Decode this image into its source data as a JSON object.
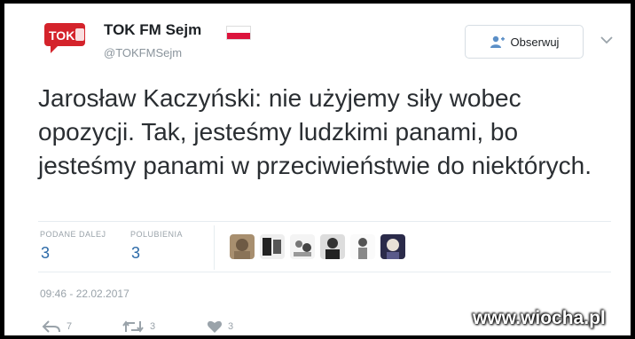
{
  "author": {
    "name": "TOK FM Sejm",
    "handle": "@TOKFMSejm",
    "avatar_text": "TOK"
  },
  "follow_label": "Obserwuj",
  "tweet_text": "Jarosław Kaczyński: nie użyjemy siły wobec opozycji. Tak, jesteśmy ludzkimi panami, bo jesteśmy panami w przeciwieństwie do niektórych.",
  "stats": {
    "retweets_label": "PODANE DALEJ",
    "retweets_value": "3",
    "likes_label": "POLUBIENIA",
    "likes_value": "3"
  },
  "timestamp": "09:46 - 22.02.2017",
  "actions": {
    "reply_count": "7",
    "retweet_count": "3",
    "like_count": "3"
  },
  "watermark": "www.wiocha.pl",
  "colors": {
    "avatar_red": "#d4232b",
    "link_blue": "#2c6aa8",
    "flag_red": "#dc143c"
  },
  "icons": {
    "follow": "person-plus-icon",
    "more": "chevron-down-icon",
    "reply": "reply-icon",
    "retweet": "retweet-icon",
    "like": "heart-icon"
  }
}
